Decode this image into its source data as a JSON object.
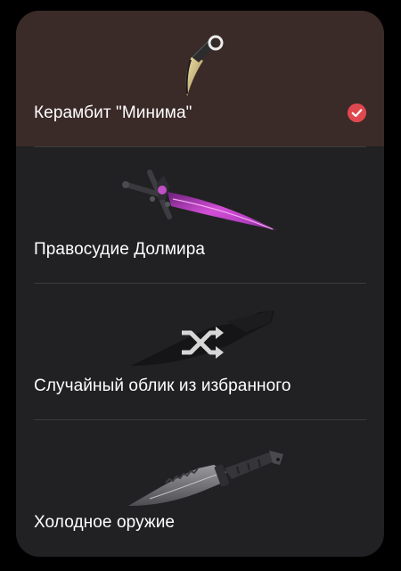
{
  "colors": {
    "panel_bg": "#212123",
    "selected_bg": "#3a2a28",
    "check_accent": "#e0484f",
    "text": "#ffffff"
  },
  "items": [
    {
      "label": "Керамбит \"Минима\"",
      "selected": true,
      "icon": "karambit-knife-icon"
    },
    {
      "label": "Правосудие Долмира",
      "selected": false,
      "icon": "purple-sword-icon"
    },
    {
      "label": "Случайный облик из избранного",
      "selected": false,
      "icon": "shuffle-icon"
    },
    {
      "label": "Холодное оружие",
      "selected": false,
      "icon": "combat-knife-icon"
    }
  ]
}
